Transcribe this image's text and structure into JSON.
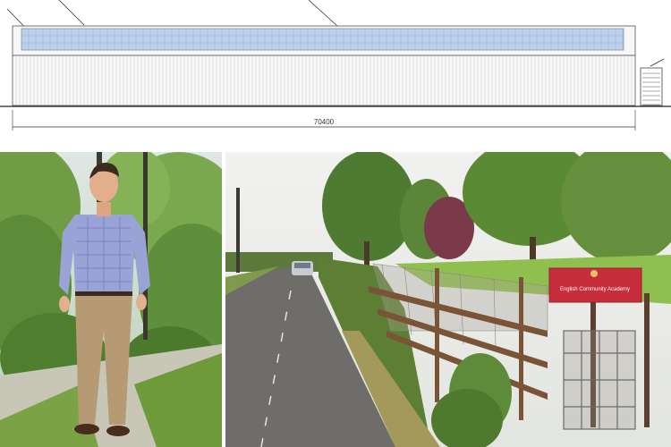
{
  "elevation": {
    "dimension_label": "70400"
  },
  "photo_farmer": {},
  "photo_road": {
    "sign_text": "English Community Academy"
  }
}
